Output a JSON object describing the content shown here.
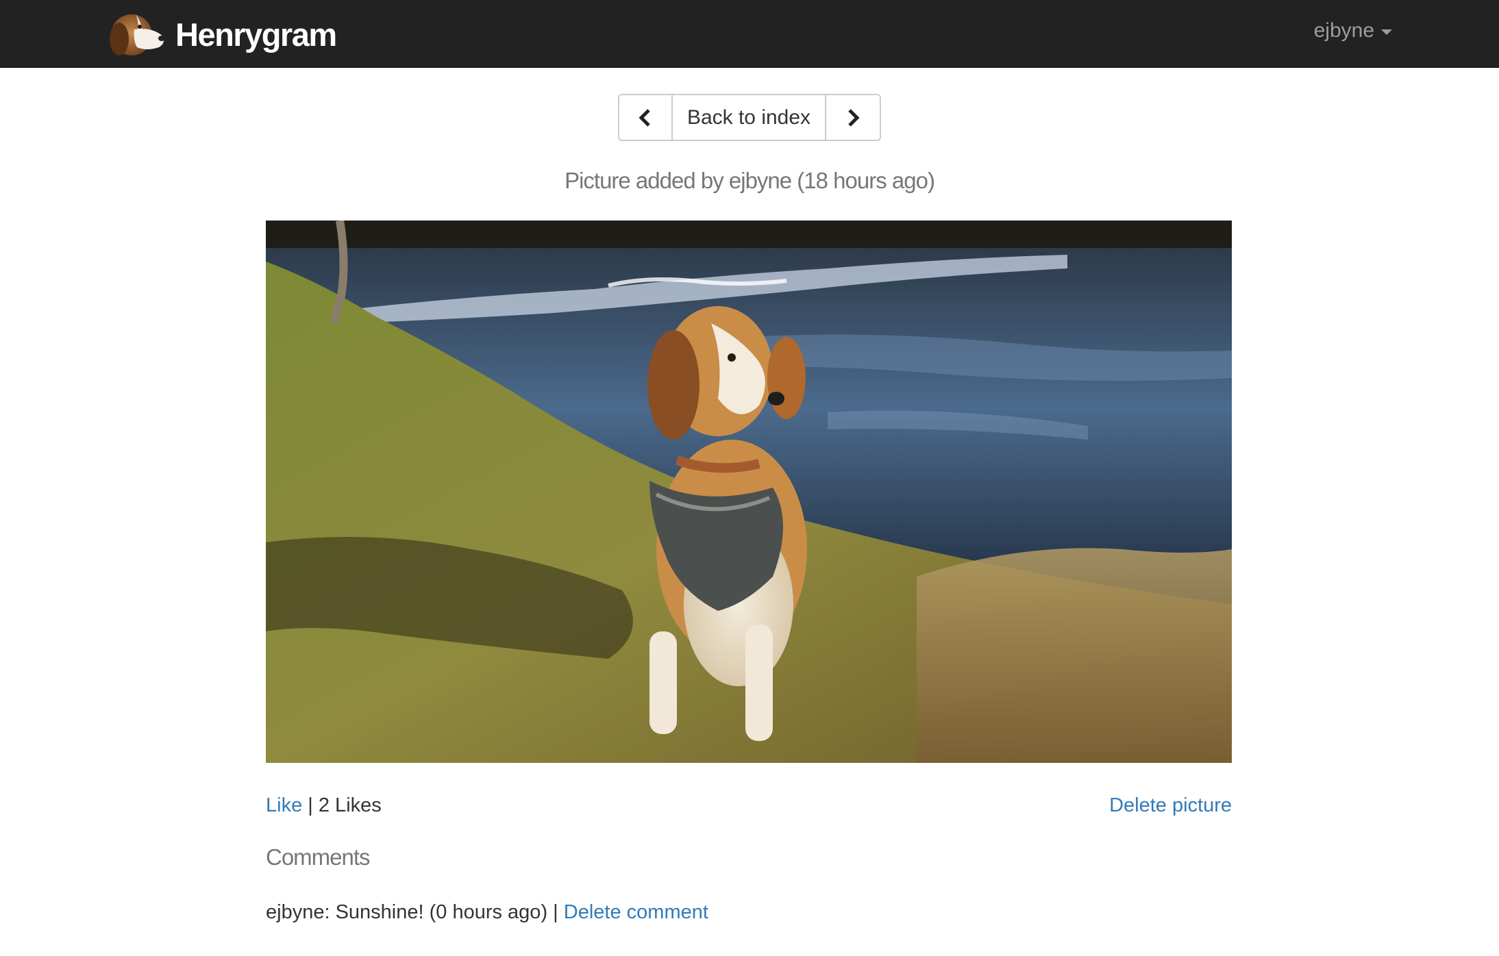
{
  "app": {
    "brand_name": "Henrygram",
    "user": "ejbyne"
  },
  "nav_buttons": {
    "prev_icon": "chevron-left-icon",
    "back_label": "Back to index",
    "next_icon": "chevron-right-icon"
  },
  "picture": {
    "caption": "Picture added by ejbyne (18 hours ago)",
    "like_label": "Like",
    "separator": "|",
    "likes_text": "2 Likes",
    "delete_label": "Delete picture"
  },
  "comments": {
    "heading": "Comments",
    "items": [
      {
        "text": "ejbyne: Sunshine! (0 hours ago)",
        "separator": "|",
        "delete_label": "Delete comment"
      }
    ]
  },
  "colors": {
    "navbar": "#222222",
    "link": "#337ab7",
    "muted": "#777777"
  }
}
